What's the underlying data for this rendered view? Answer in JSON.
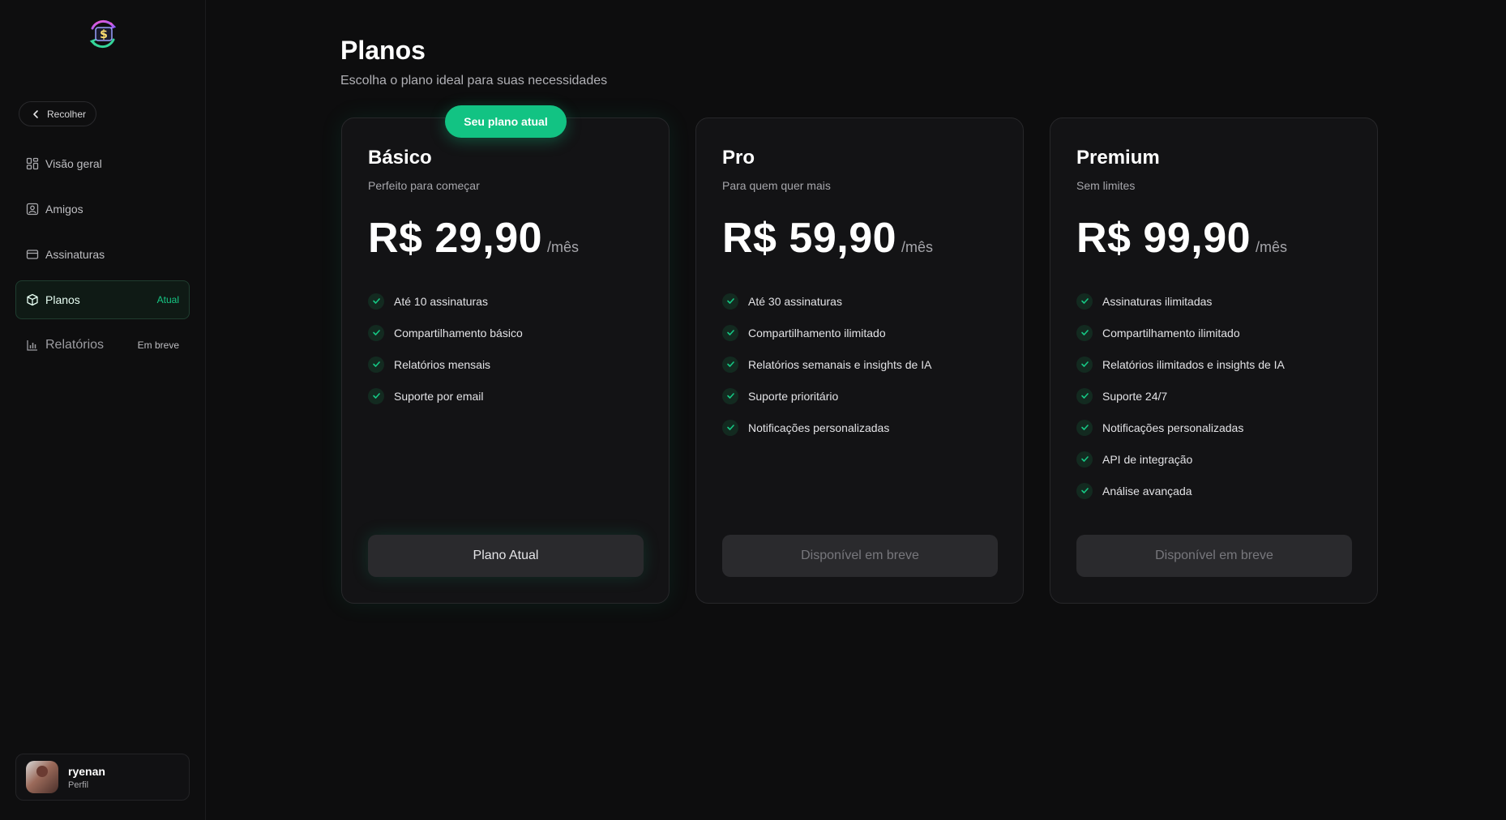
{
  "sidebar": {
    "collapse_label": "Recolher",
    "items": [
      {
        "label": "Visão geral",
        "icon": "dashboard-icon"
      },
      {
        "label": "Amigos",
        "icon": "contact-icon"
      },
      {
        "label": "Assinaturas",
        "icon": "card-icon"
      },
      {
        "label": "Planos",
        "icon": "box-icon",
        "tag": "Atual"
      },
      {
        "label": "Relatórios",
        "icon": "bar-chart-icon",
        "tag": "Em breve"
      }
    ],
    "profile": {
      "name": "ryenan",
      "subtitle": "Perfil"
    }
  },
  "main": {
    "title": "Planos",
    "subtitle": "Escolha o plano ideal para suas necessidades",
    "current_badge": "Seu plano atual",
    "plans": [
      {
        "name": "Básico",
        "description": "Perfeito para começar",
        "price": "R$ 29,90",
        "period": "/mês",
        "features": [
          "Até 10 assinaturas",
          "Compartilhamento básico",
          "Relatórios mensais",
          "Suporte por email"
        ],
        "button": "Plano Atual"
      },
      {
        "name": "Pro",
        "description": "Para quem quer mais",
        "price": "R$ 59,90",
        "period": "/mês",
        "features": [
          "Até 30 assinaturas",
          "Compartilhamento ilimitado",
          "Relatórios semanais e insights de IA",
          "Suporte prioritário",
          "Notificações personalizadas"
        ],
        "button": "Disponível em breve"
      },
      {
        "name": "Premium",
        "description": "Sem limites",
        "price": "R$ 99,90",
        "period": "/mês",
        "features": [
          "Assinaturas ilimitadas",
          "Compartilhamento ilimitado",
          "Relatórios ilimitados e insights de IA",
          "Suporte 24/7",
          "Notificações personalizadas",
          "API de integração",
          "Análise avançada"
        ],
        "button": "Disponível em breve"
      }
    ]
  },
  "colors": {
    "accent": "#12c383",
    "background": "#0d0d0e",
    "card": "#131315"
  }
}
